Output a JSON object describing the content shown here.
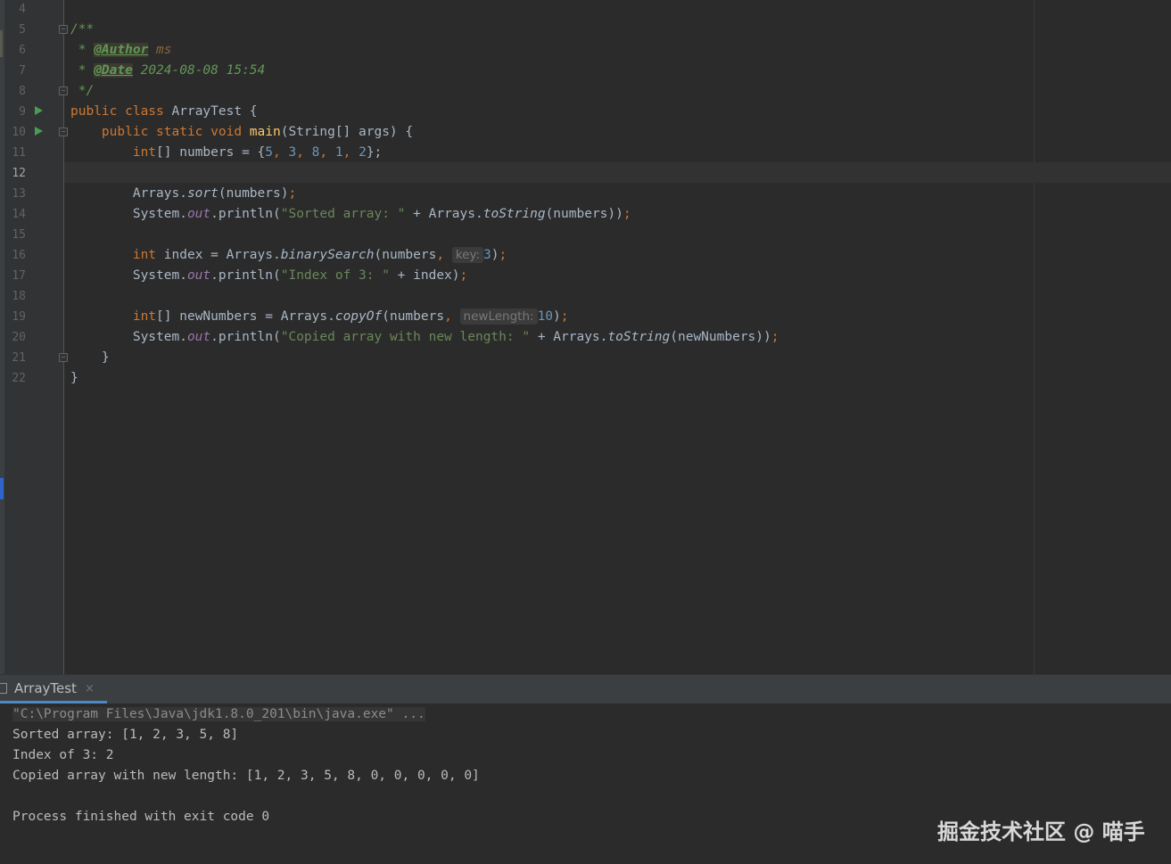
{
  "editor": {
    "line_numbers": [
      "4",
      "5",
      "6",
      "7",
      "8",
      "9",
      "10",
      "11",
      "12",
      "13",
      "14",
      "15",
      "16",
      "17",
      "18",
      "19",
      "20",
      "21",
      "22"
    ],
    "current_line": "12",
    "code": {
      "l5": "/**",
      "l6_star": " * ",
      "l6_tag": "@Author",
      "l6_val": " ms",
      "l7_star": " * ",
      "l7_tag": "@Date",
      "l7_val": " 2024-08-08 15:54",
      "l8": " */",
      "l9_kw": "public class ",
      "l9_rest": "ArrayTest {",
      "l10_indent": "    ",
      "l10_kw": "public static void ",
      "l10_fn": "main",
      "l10_rest": "(String[] args) {",
      "l11_indent": "        ",
      "l11_kw": "int",
      "l11_a": "[] numbers = {",
      "l11_n1": "5",
      "l11_n2": "3",
      "l11_n3": "8",
      "l11_n4": "1",
      "l11_n5": "2",
      "l11_end": "};",
      "l13_indent": "        ",
      "l13_a": "Arrays.",
      "l13_m": "sort",
      "l13_b": "(numbers)",
      "l14_indent": "        ",
      "l14_a": "System.",
      "l14_f": "out",
      "l14_b": ".println(",
      "l14_s": "\"Sorted array: \"",
      "l14_c": " + Arrays.",
      "l14_m": "toString",
      "l14_d": "(numbers))",
      "l16_indent": "        ",
      "l16_kw": "int",
      "l16_a": " index = Arrays.",
      "l16_m": "binarySearch",
      "l16_b": "(numbers",
      "l16_hint": "key:",
      "l16_n": "3",
      "l16_c": ")",
      "l17_indent": "        ",
      "l17_a": "System.",
      "l17_f": "out",
      "l17_b": ".println(",
      "l17_s": "\"Index of 3: \"",
      "l17_c": " + index)",
      "l19_indent": "        ",
      "l19_kw": "int",
      "l19_a": "[] newNumbers = Arrays.",
      "l19_m": "copyOf",
      "l19_b": "(numbers",
      "l19_hint": "newLength:",
      "l19_n": "10",
      "l19_c": ")",
      "l20_indent": "        ",
      "l20_a": "System.",
      "l20_f": "out",
      "l20_b": ".println(",
      "l20_s": "\"Copied array with new length: \"",
      "l20_c": " + Arrays.",
      "l20_m": "toString",
      "l20_d": "(newNumbers))",
      "l21": "    }",
      "l22": "}",
      "comma": ", ",
      "semicolon": ";"
    }
  },
  "run_panel": {
    "tab_label": "ArrayTest",
    "tab_close": "×",
    "output": {
      "command": "\"C:\\Program Files\\Java\\jdk1.8.0_201\\bin\\java.exe\" ...",
      "line1": "Sorted array: [1, 2, 3, 5, 8]",
      "line2": "Index of 3: 2",
      "line3": "Copied array with new length: [1, 2, 3, 5, 8, 0, 0, 0, 0, 0]",
      "line4": "Process finished with exit code 0"
    }
  },
  "watermark": "掘金技术社区 @ 喵手",
  "colors": {
    "background": "#2b2b2b",
    "keyword": "#cc7832",
    "string": "#6a8759",
    "number": "#6897bb",
    "method": "#ffc66d",
    "field": "#9876aa",
    "run_icon": "#499c54"
  }
}
